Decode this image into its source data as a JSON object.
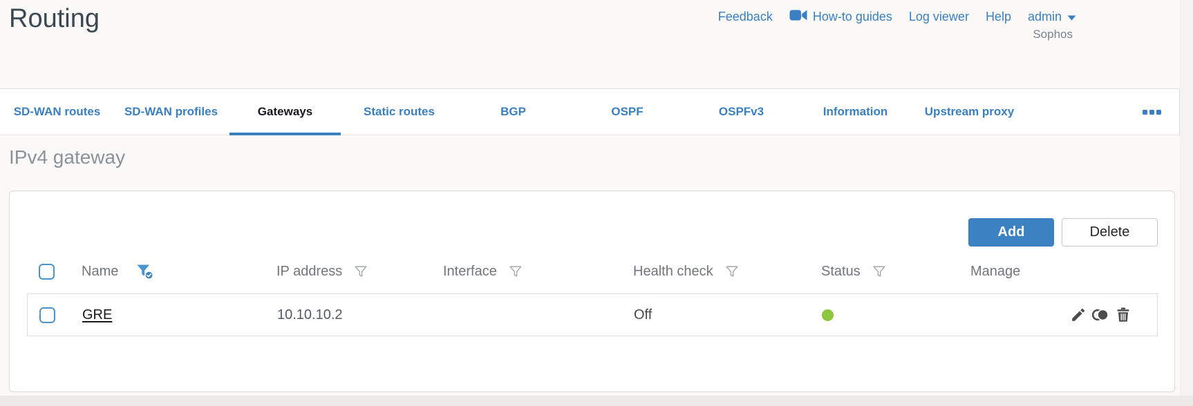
{
  "header": {
    "title": "Routing",
    "brand": "Sophos",
    "links": {
      "feedback": "Feedback",
      "howto": "How-to guides",
      "logviewer": "Log viewer",
      "help": "Help",
      "admin": "admin"
    }
  },
  "tabs": [
    {
      "label": "SD-WAN routes",
      "active": false
    },
    {
      "label": "SD-WAN profiles",
      "active": false
    },
    {
      "label": "Gateways",
      "active": true
    },
    {
      "label": "Static routes",
      "active": false
    },
    {
      "label": "BGP",
      "active": false
    },
    {
      "label": "OSPF",
      "active": false
    },
    {
      "label": "OSPFv3",
      "active": false
    },
    {
      "label": "Information",
      "active": false
    },
    {
      "label": "Upstream proxy",
      "active": false
    }
  ],
  "section": {
    "title": "IPv4 gateway"
  },
  "toolbar": {
    "add_label": "Add",
    "delete_label": "Delete"
  },
  "table": {
    "columns": [
      {
        "label": "Name",
        "filter": "active"
      },
      {
        "label": "IP address",
        "filter": "inactive"
      },
      {
        "label": "Interface",
        "filter": "inactive"
      },
      {
        "label": "Health check",
        "filter": "inactive"
      },
      {
        "label": "Status",
        "filter": "inactive"
      },
      {
        "label": "Manage",
        "filter": "none"
      }
    ],
    "rows": [
      {
        "name": "GRE",
        "ip_address": "10.10.10.2",
        "interface": "",
        "health_check": "Off",
        "status": "up"
      }
    ]
  },
  "icons": {
    "howto": "video-camera",
    "admin_caret": "chevron-down",
    "filter": "funnel",
    "filter_active": "funnel-check",
    "overflow": "ellipsis",
    "status": "green-dot",
    "manage": [
      "edit-pencil",
      "clone",
      "trash"
    ]
  },
  "colors": {
    "accent_blue": "#3c82c3",
    "link_blue": "#3a80c0",
    "status_green": "#8dc63f"
  }
}
